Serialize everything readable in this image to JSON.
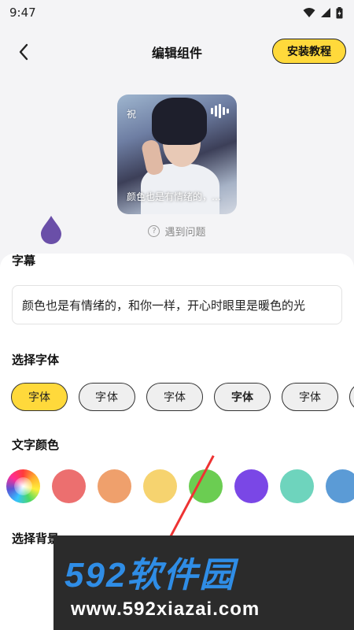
{
  "status_bar": {
    "time": "9:47"
  },
  "header": {
    "title": "编辑组件",
    "tutorial_label": "安装教程"
  },
  "preview": {
    "card_label": "祝",
    "caption": "颜色也是有情绪的，…"
  },
  "help_link": "遇到问题",
  "subtitle_section": {
    "title": "字幕",
    "value": "颜色也是有情绪的，和你一样，开心时眼里是暖色的光"
  },
  "font_section": {
    "title": "选择字体",
    "options": [
      "字体",
      "字体",
      "字体",
      "字体",
      "字体"
    ],
    "selected_index": 0
  },
  "color_section": {
    "title": "文字颜色",
    "swatches": [
      "rainbow",
      "#ec6f6f",
      "#efa06c",
      "#f6d36f",
      "#6bcd52",
      "#7a47e6",
      "#6ed4bd",
      "#5b9bd6"
    ],
    "selected_index": 5
  },
  "background_section": {
    "title": "选择背景"
  },
  "colors": {
    "accent_yellow": "#ffd93b",
    "drop_purple": "#6a4fa8"
  },
  "watermark": {
    "brand": "592软件园",
    "url": "www.592xiazai.com"
  }
}
